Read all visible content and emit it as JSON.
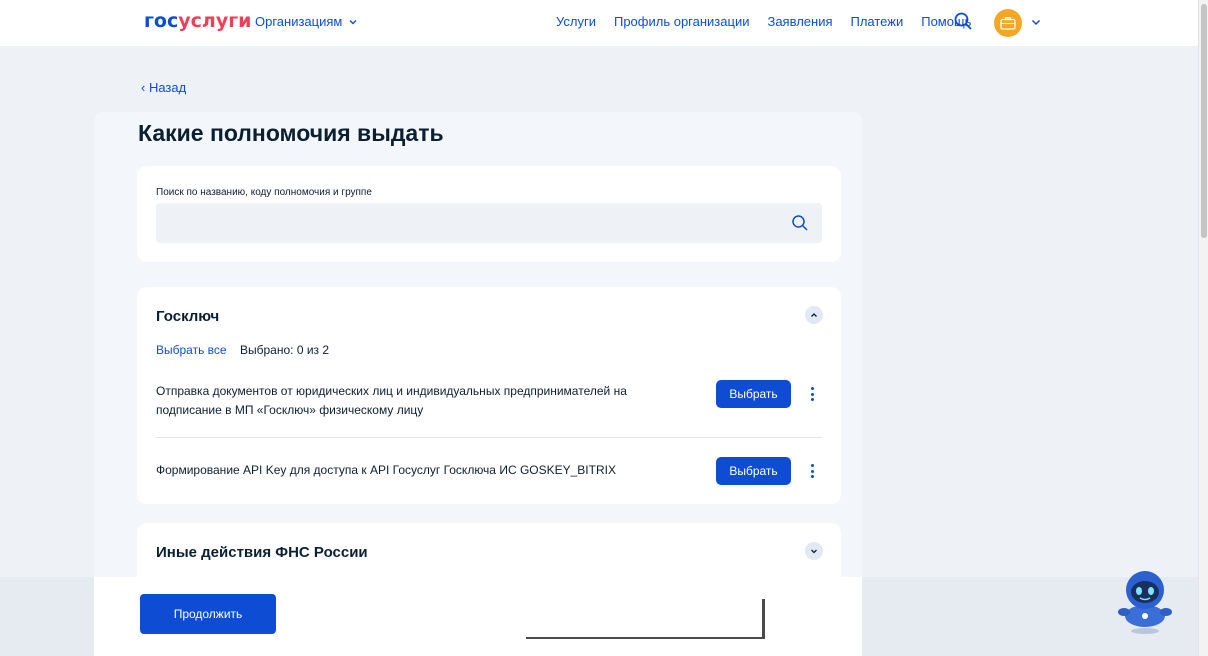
{
  "header": {
    "logo_part1": "гос",
    "logo_part2": "услуги",
    "org_menu_label": "Организациям",
    "nav": [
      "Услуги",
      "Профиль организации",
      "Заявления",
      "Платежи",
      "Помощь"
    ]
  },
  "back_label": "Назад",
  "modal": {
    "title": "Какие полномочия выдать",
    "search": {
      "label": "Поиск по названию, коду полномочия и группе",
      "value": "",
      "placeholder": ""
    },
    "groups": [
      {
        "title": "Госключ",
        "expanded": true,
        "select_all_label": "Выбрать все",
        "selected_count": "Выбрано: 0 из 2",
        "permissions": [
          {
            "text": "Отправка документов от юридических лиц и индивидуальных предпринимателей на подписание в МП «Госключ» физическому лицу",
            "button_label": "Выбрать"
          },
          {
            "text": "Формирование API Key для доступа к API Госуслуг Госключа ИС GOSKEY_BITRIX",
            "button_label": "Выбрать"
          }
        ]
      },
      {
        "title": "Иные действия ФНС России",
        "expanded": false
      }
    ],
    "continue_label": "Продолжить"
  },
  "colors": {
    "primary": "#0d4cd3",
    "logo_accent": "#ee3f58",
    "avatar": "#f5a623",
    "modal_bg": "#f3f6fb"
  },
  "icons": {
    "org_chevron": "chevron-down-icon",
    "search_top": "search-icon",
    "avatar": "briefcase-icon",
    "collapse": "chevron-up-icon",
    "expand": "chevron-down-icon",
    "more": "kebab-menu-icon",
    "assistant": "robot-assistant-icon"
  }
}
